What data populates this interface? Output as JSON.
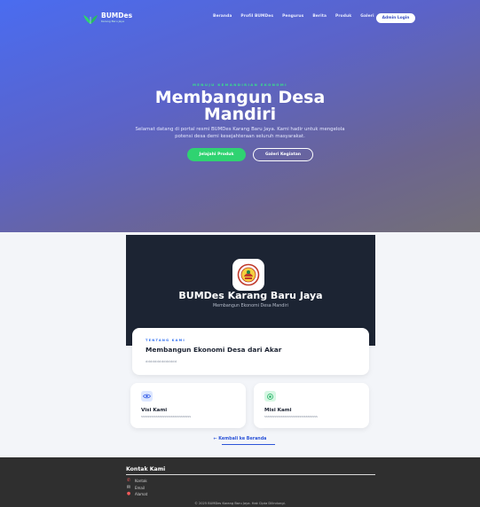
{
  "nav": {
    "brand_name": "BUMDes",
    "brand_sub": "Karang Baru Jaya",
    "menu": [
      "Beranda",
      "Profil BUMDes",
      "Pengurus",
      "Berita",
      "Produk",
      "Galeri"
    ],
    "admin_label": "Admin Login"
  },
  "hero": {
    "eyebrow": "MENUJU KEMANDIRIAN EKONOMI",
    "title_line1": "Membangun Desa",
    "title_line2": "Mandiri",
    "description": "Selamat datang di portal resmi BUMDes Karang Baru Jaya. Kami hadir untuk mengelola potensi desa demi kesejahteraan seluruh masyarakat.",
    "btn_products": "Jelajahi Produk",
    "btn_gallery": "Galeri Kegiatan"
  },
  "profile": {
    "name": "BUMDes Karang Baru Jaya",
    "tagline": "Membangun Ekonomi Desa Mandiri"
  },
  "about": {
    "label": "TENTANG KAMI",
    "title": "Membangun Ekonomi Desa dari Akar",
    "text": "dddddddddddddd"
  },
  "visi": {
    "icon": "eye-icon",
    "title": "Visi Kami",
    "text": "ssssssssssssssssssssssssssssss"
  },
  "misi": {
    "icon": "target-icon",
    "title": "Misi Kami",
    "text": "ssssssssssssssssssssssssssssssss"
  },
  "back_link": "Kembali ke Beranda",
  "footer": {
    "title": "Kontak Kami",
    "phone": "Kontak",
    "email": "Email",
    "address": "Alamat",
    "copyright": "© 2025 BUMDes Karang Baru Jaya. Hak Cipta Dilindungi."
  },
  "colors": {
    "accent": "#2fd371",
    "primary": "#4a6cf0",
    "dark": "#1c2433",
    "footer": "#2f2f2f"
  }
}
